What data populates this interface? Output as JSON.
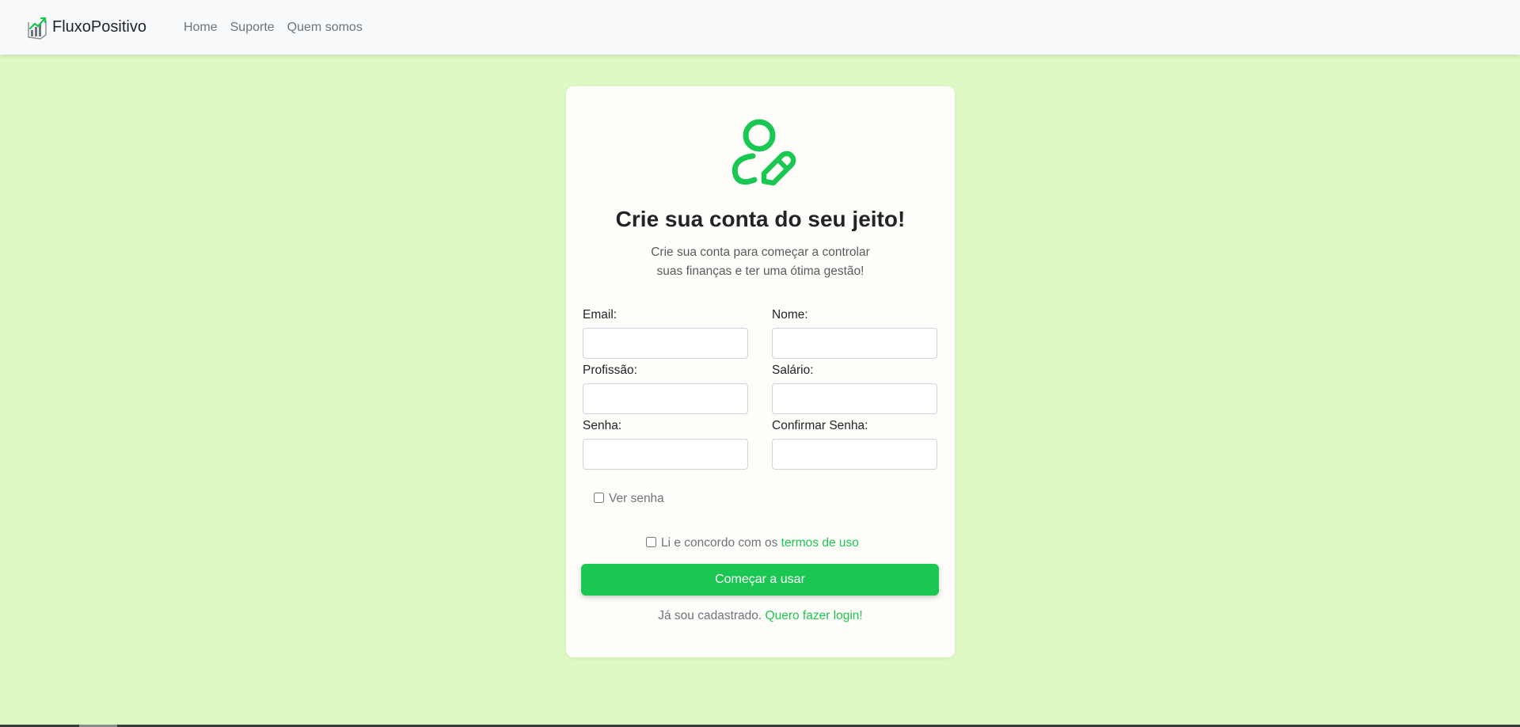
{
  "navbar": {
    "brand": "FluxoPositivo",
    "logo_icon": "chart-growth-icon",
    "links": [
      {
        "label": "Home"
      },
      {
        "label": "Suporte"
      },
      {
        "label": "Quem somos"
      }
    ]
  },
  "card": {
    "icon": "user-edit-icon",
    "icon_color": "#19c752",
    "title": "Crie sua conta do seu jeito!",
    "subtitle_line1": "Crie sua conta para começar a controlar",
    "subtitle_line2": "suas finanças e ter uma ótima gestão!",
    "fields": {
      "email": {
        "label": "Email:",
        "value": ""
      },
      "nome": {
        "label": "Nome:",
        "value": ""
      },
      "profissao": {
        "label": "Profissão:",
        "value": ""
      },
      "salario": {
        "label": "Salário:",
        "value": ""
      },
      "senha": {
        "label": "Senha:",
        "value": ""
      },
      "confirmar_senha": {
        "label": "Confirmar Senha:",
        "value": ""
      }
    },
    "show_password": {
      "label": "Ver senha",
      "checked": false
    },
    "terms": {
      "prefix": "Li e concordo com os",
      "link": "termos de uso",
      "checked": false
    },
    "submit_label": "Começar a usar",
    "login": {
      "prefix": "Já sou cadastrado.",
      "link": "Quero fazer login!"
    }
  },
  "colors": {
    "background": "#dff9c5",
    "accent": "#19c752",
    "navbar": "#f8f9fa",
    "card": "#fefdf9"
  }
}
